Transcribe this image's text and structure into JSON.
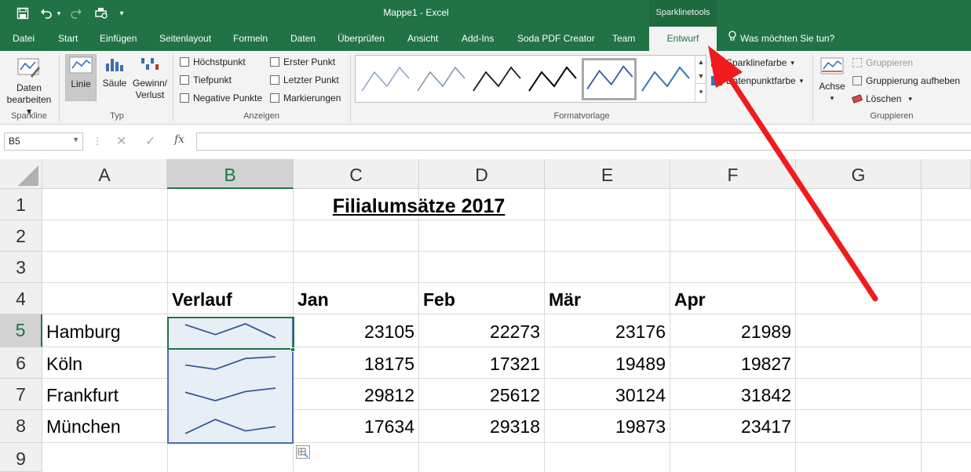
{
  "titlebar": {
    "document_title": "Mappe1  -  Excel",
    "context_group": "Sparklinetools"
  },
  "tabs": [
    "Datei",
    "Start",
    "Einfügen",
    "Seitenlayout",
    "Formeln",
    "Daten",
    "Überprüfen",
    "Ansicht",
    "Add-Ins",
    "Soda PDF Creator",
    "Team",
    "Entwurf"
  ],
  "active_tab": "Entwurf",
  "tell_me": "Was möchten Sie tun?",
  "ribbon": {
    "sparkline_group": {
      "edit_data_line1": "Daten",
      "edit_data_line2": "bearbeiten",
      "label": "Sparkline"
    },
    "type_group": {
      "line": "Linie",
      "column": "Säule",
      "winloss_line1": "Gewinn/",
      "winloss_line2": "Verlust",
      "label": "Typ"
    },
    "show_group": {
      "high_point": "Höchstpunkt",
      "low_point": "Tiefpunkt",
      "negative_points": "Negative Punkte",
      "first_point": "Erster Punkt",
      "last_point": "Letzter Punkt",
      "markers": "Markierungen",
      "label": "Anzeigen"
    },
    "style_group": {
      "label": "Formatvorlage"
    },
    "sparkline_color": "Sparklinefarbe",
    "marker_color": "Datenpunktfarbe",
    "axis": "Achse",
    "group_group": {
      "group": "Gruppieren",
      "ungroup": "Gruppierung aufheben",
      "clear": "Löschen",
      "label": "Gruppieren"
    }
  },
  "formula_bar": {
    "name_box": "B5",
    "fx": "fx",
    "formula": ""
  },
  "columns": [
    "A",
    "B",
    "C",
    "D",
    "E",
    "F",
    "G"
  ],
  "rows": [
    "1",
    "2",
    "3",
    "4",
    "5",
    "6",
    "7",
    "8",
    "9"
  ],
  "sheet": {
    "title": "Filialumsätze 2017",
    "header_verlauf": "Verlauf",
    "months": [
      "Jan",
      "Feb",
      "Mär",
      "Apr"
    ],
    "branches": [
      {
        "name": "Hamburg",
        "values": [
          "23105",
          "22273",
          "23176",
          "21989"
        ]
      },
      {
        "name": "Köln",
        "values": [
          "18175",
          "17321",
          "19489",
          "19827"
        ]
      },
      {
        "name": "Frankfurt",
        "values": [
          "29812",
          "25612",
          "30124",
          "31842"
        ]
      },
      {
        "name": "München",
        "values": [
          "17634",
          "29318",
          "19873",
          "23417"
        ]
      }
    ]
  },
  "colors": {
    "excel_green": "#217346",
    "sparkline": "#3a5a94",
    "arrow": "#f01b1b"
  }
}
